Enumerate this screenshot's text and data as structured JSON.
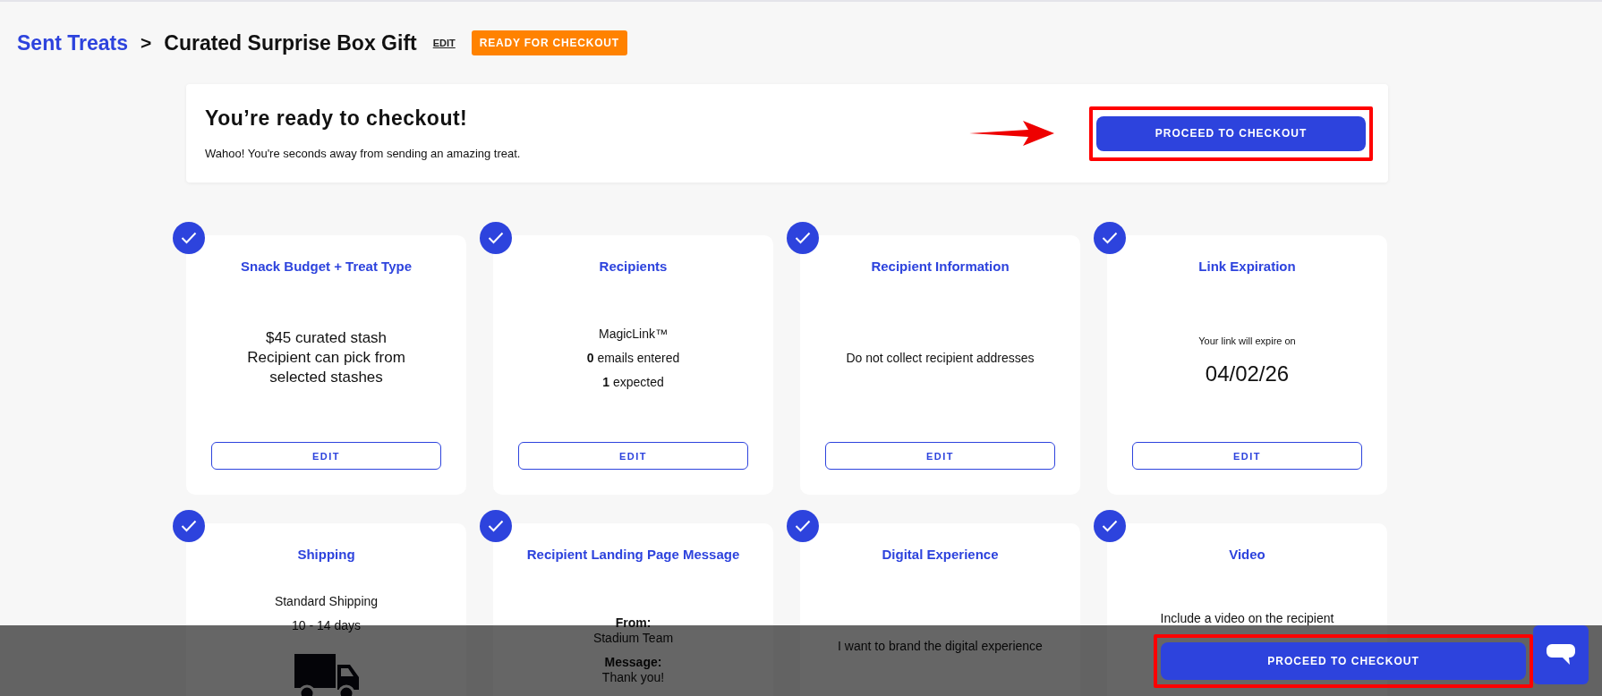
{
  "breadcrumb": {
    "parent": "Sent Treats",
    "separator": ">",
    "current": "Curated Surprise Box Gift",
    "edit_link": "EDIT",
    "status_badge": "READY FOR CHECKOUT"
  },
  "banner": {
    "title": "You’re ready to checkout!",
    "subtitle": "Wahoo! You're seconds away from sending an amazing treat.",
    "button": "PROCEED TO CHECKOUT",
    "highlighted": true
  },
  "cards": [
    {
      "title": "Snack Budget + Treat Type",
      "complete": true,
      "lines": [
        {
          "kind": "large",
          "text": "$45 curated stash"
        },
        {
          "kind": "large",
          "text": "Recipient can pick from"
        },
        {
          "kind": "large",
          "text": "selected stashes"
        }
      ],
      "edit": "EDIT"
    },
    {
      "title": "Recipients",
      "complete": true,
      "lines": [
        {
          "kind": "normal",
          "text": "MagicLink™"
        },
        {
          "kind": "normal",
          "text": "**0** emails entered"
        },
        {
          "kind": "normal",
          "text": "**1** expected"
        }
      ],
      "edit": "EDIT"
    },
    {
      "title": "Recipient Information",
      "complete": true,
      "lines": [
        {
          "kind": "normal",
          "text": "Do not collect recipient addresses"
        }
      ],
      "edit": "EDIT"
    },
    {
      "title": "Link Expiration",
      "complete": true,
      "lines": [
        {
          "kind": "small",
          "text": "Your link will expire on"
        },
        {
          "kind": "date",
          "text": "04/02/26"
        }
      ],
      "edit": "EDIT"
    },
    {
      "title": "Shipping",
      "complete": true,
      "lines": [
        {
          "kind": "normal",
          "text": "Standard Shipping"
        },
        {
          "kind": "normal",
          "text": "10 - 14 days"
        },
        {
          "kind": "truck"
        }
      ]
    },
    {
      "title": "Recipient Landing Page Message",
      "complete": true,
      "lines": [
        {
          "kind": "label",
          "text": "From:"
        },
        {
          "kind": "tight",
          "text": "Stadium Team"
        },
        {
          "kind": "label",
          "text": "Message:"
        },
        {
          "kind": "tight",
          "text": "Thank you!"
        }
      ]
    },
    {
      "title": "Digital Experience",
      "complete": true,
      "lines": [
        {
          "kind": "normal",
          "text": "I want to brand the digital experience"
        }
      ]
    },
    {
      "title": "Video",
      "complete": true,
      "lines": [
        {
          "kind": "raised",
          "text": "Include a video on the recipient"
        }
      ]
    }
  ],
  "bottom_bar": {
    "button": "PROCEED TO CHECKOUT",
    "highlighted": true
  }
}
